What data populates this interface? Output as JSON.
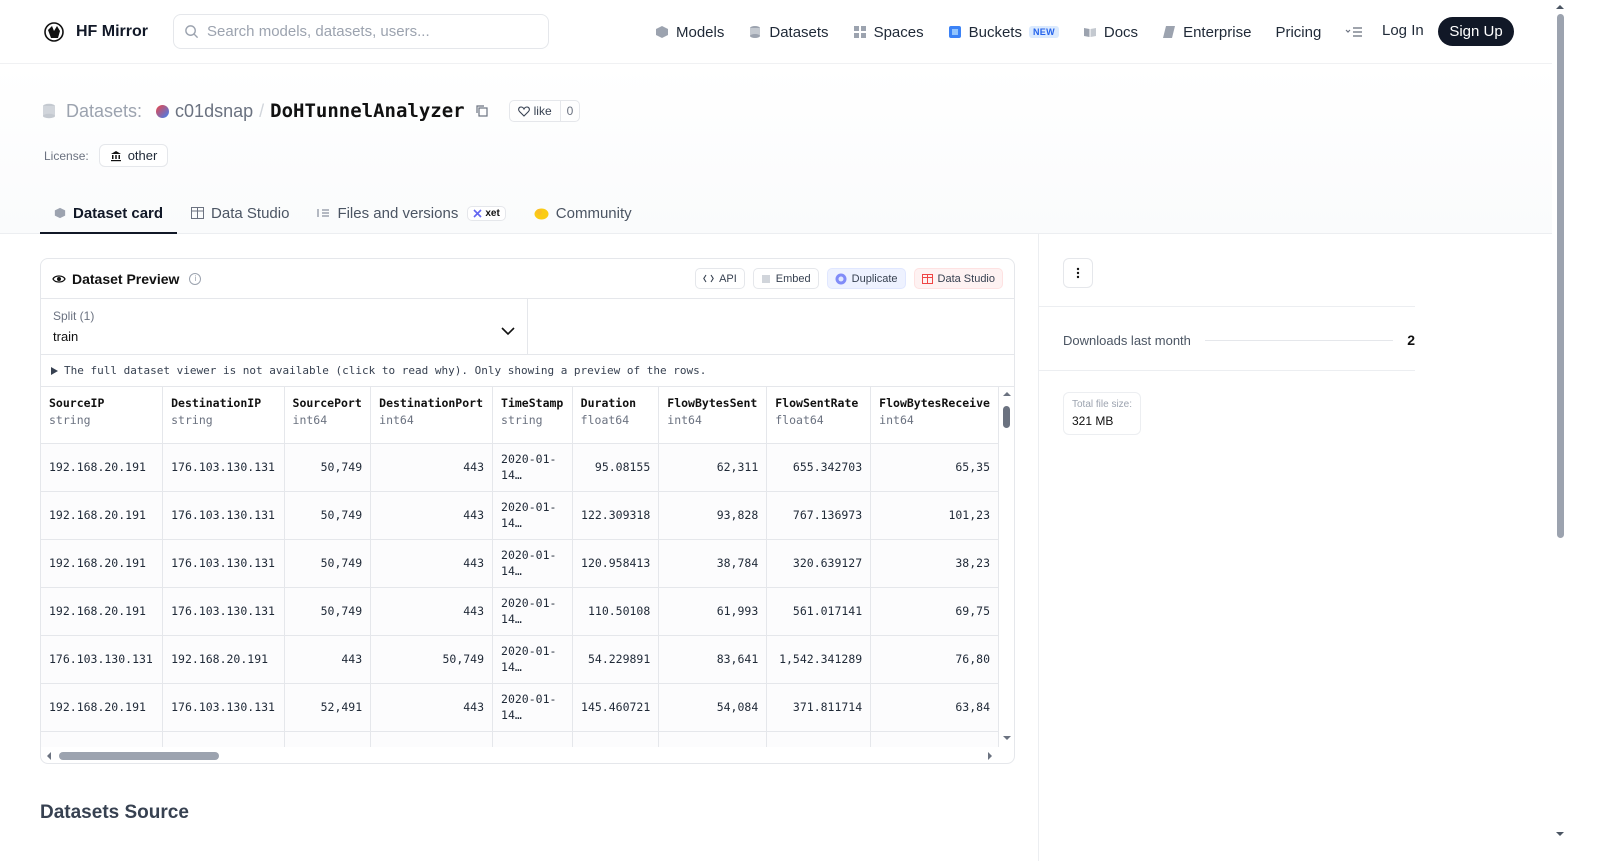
{
  "nav": {
    "brand": "HF Mirror",
    "search_placeholder": "Search models, datasets, users...",
    "links": [
      {
        "label": "Models",
        "icon": "model-cube-icon"
      },
      {
        "label": "Datasets",
        "icon": "database-icon"
      },
      {
        "label": "Spaces",
        "icon": "spaces-grid-icon"
      },
      {
        "label": "Buckets",
        "icon": "bucket-icon",
        "badge": "NEW"
      },
      {
        "label": "Docs",
        "icon": "book-icon"
      },
      {
        "label": "Enterprise",
        "icon": "enterprise-icon"
      },
      {
        "label": "Pricing"
      }
    ],
    "more_icon": "menu-more-icon",
    "login": "Log In",
    "signup": "Sign Up"
  },
  "header": {
    "kind": "Datasets:",
    "owner": "c01dsnap",
    "separator": "/",
    "repo": "DoHTunnelAnalyzer",
    "like_label": "like",
    "like_count": "0",
    "license_label": "License:",
    "license_value": "other"
  },
  "tabs": [
    {
      "label": "Dataset card",
      "icon": "dataset-card-icon",
      "active": true
    },
    {
      "label": "Data Studio",
      "icon": "table-icon"
    },
    {
      "label": "Files and versions",
      "icon": "files-icon",
      "badge": "xet"
    },
    {
      "label": "Community",
      "icon": "community-icon"
    }
  ],
  "preview": {
    "title": "Dataset Preview",
    "actions": {
      "api": "API",
      "embed": "Embed",
      "duplicate": "Duplicate",
      "data_studio": "Data Studio"
    },
    "split_label": "Split (1)",
    "split_value": "train",
    "notice": "The full dataset viewer is not available (click to read why). Only showing a preview of the rows.",
    "columns": [
      {
        "name": "SourceIP",
        "type": "string"
      },
      {
        "name": "DestinationIP",
        "type": "string"
      },
      {
        "name": "SourcePort",
        "type": "int64"
      },
      {
        "name": "DestinationPort",
        "type": "int64"
      },
      {
        "name": "TimeStamp",
        "type": "string"
      },
      {
        "name": "Duration",
        "type": "float64"
      },
      {
        "name": "FlowBytesSent",
        "type": "int64"
      },
      {
        "name": "FlowSentRate",
        "type": "float64"
      },
      {
        "name": "FlowBytesReceive",
        "type": "int64"
      }
    ],
    "rows": [
      [
        "192.168.20.191",
        "176.103.130.131",
        "50,749",
        "443",
        "2020-01-14…",
        "95.08155",
        "62,311",
        "655.342703",
        "65,35"
      ],
      [
        "192.168.20.191",
        "176.103.130.131",
        "50,749",
        "443",
        "2020-01-14…",
        "122.309318",
        "93,828",
        "767.136973",
        "101,23"
      ],
      [
        "192.168.20.191",
        "176.103.130.131",
        "50,749",
        "443",
        "2020-01-14…",
        "120.958413",
        "38,784",
        "320.639127",
        "38,23"
      ],
      [
        "192.168.20.191",
        "176.103.130.131",
        "50,749",
        "443",
        "2020-01-14…",
        "110.50108",
        "61,993",
        "561.017141",
        "69,75"
      ],
      [
        "176.103.130.131",
        "192.168.20.191",
        "443",
        "50,749",
        "2020-01-14…",
        "54.229891",
        "83,641",
        "1,542.341289",
        "76,80"
      ],
      [
        "192.168.20.191",
        "176.103.130.131",
        "52,491",
        "443",
        "2020-01-14…",
        "145.460721",
        "54,084",
        "371.811714",
        "63,84"
      ],
      [
        "",
        "",
        "",
        "",
        "2020-01-",
        "",
        "",
        "",
        ""
      ]
    ]
  },
  "section_title": "Datasets Source",
  "sidebar": {
    "downloads_label": "Downloads last month",
    "downloads_value": "2",
    "filesize_label": "Total file size:",
    "filesize_value": "321 MB"
  }
}
